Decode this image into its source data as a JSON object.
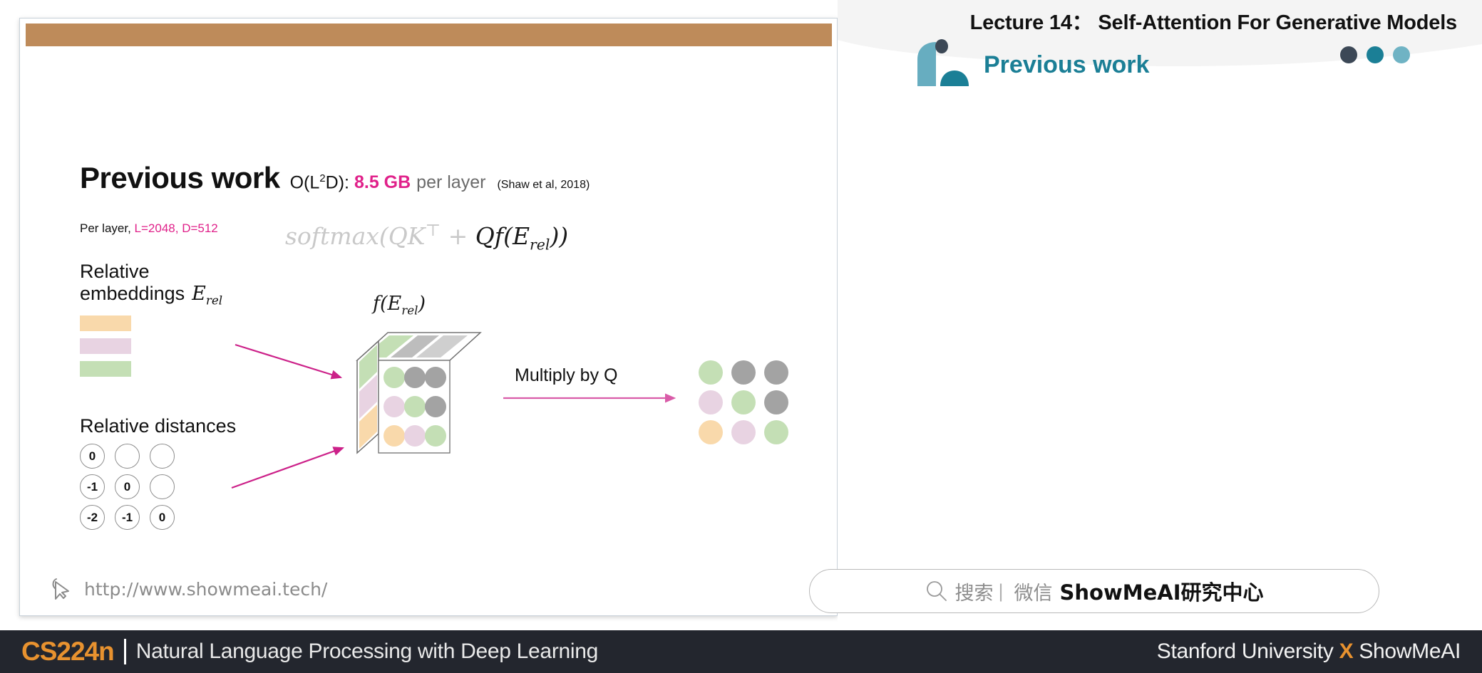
{
  "slide": {
    "title_main": "Previous work",
    "title_complexity_prefix": "O(L",
    "title_complexity_sup": "2",
    "title_complexity_suffix": "D):",
    "title_memory": "8.5 GB",
    "title_per_layer": "per layer",
    "title_citation": "(Shaw et al, 2018)",
    "per_layer_prefix": "Per layer, ",
    "per_layer_values": "L=2048, D=512",
    "formula_plain_1": "softmax(QK",
    "formula_sup": "⊤",
    "formula_plain_2": " + ",
    "formula_dark": "Qf(E",
    "formula_dark_sub": "rel",
    "formula_dark_end": "))",
    "rel_emb_line1": "Relative",
    "rel_emb_line2": "embeddings",
    "rel_emb_symbol": "E",
    "rel_emb_symbol_sub": "rel",
    "embedding_bars": [
      "#f9d9ab",
      "#e8d3e2",
      "#c4dfb5"
    ],
    "rel_dist_label": "Relative distances",
    "rel_dist_rows": [
      [
        "0",
        "",
        ""
      ],
      [
        "-1",
        "0",
        ""
      ],
      [
        "-2",
        "-1",
        "0"
      ]
    ],
    "cube_label_f": "f(E",
    "cube_label_sub": "rel",
    "cube_label_end": ")",
    "cube_side_bands": [
      "#c4dfb5",
      "#e8d3e2",
      "#f9d9ab"
    ],
    "cube_top_bands": [
      "#c4dfb5",
      "#bdbdbd",
      "#cfcfcf"
    ],
    "cube_front_dots": [
      [
        "#c4dfb5",
        "#a3a3a3",
        "#a3a3a3"
      ],
      [
        "#e8d3e2",
        "#c4dfb5",
        "#a3a3a3"
      ],
      [
        "#f9d9ab",
        "#e8d3e2",
        "#c4dfb5"
      ]
    ],
    "multiply_label": "Multiply by Q",
    "output_dots": [
      [
        "#c4dfb5",
        "#a3a3a3",
        "#a3a3a3"
      ],
      [
        "#e8d3e2",
        "#c4dfb5",
        "#a3a3a3"
      ],
      [
        "#f9d9ab",
        "#e8d3e2",
        "#c4dfb5"
      ]
    ],
    "footer_url": "http://www.showmeai.tech/",
    "topbar_color": "#be8b5a",
    "arrow_color": "#cc2189"
  },
  "right_panel": {
    "lecture_title": "Lecture 14： Self-Attention For Generative Models",
    "section_heading": "Previous work",
    "accent_color": "#1b7f96",
    "header_dots": [
      "#3c4856",
      "#1b7f96",
      "#6fb3c4"
    ],
    "search": {
      "icon": "search-icon",
      "label_cn": "搜索",
      "separator": "|",
      "channel_cn": "微信",
      "brand": "ShowMeAI研究中心"
    }
  },
  "bottom_bar": {
    "course_code": "CS224n",
    "course_name": "Natural Language Processing with Deep Learning",
    "affiliation_prefix": "Stanford University ",
    "affiliation_x": "X",
    "affiliation_suffix": " ShowMeAI",
    "background": "#23262e",
    "accent": "#e8922f"
  }
}
